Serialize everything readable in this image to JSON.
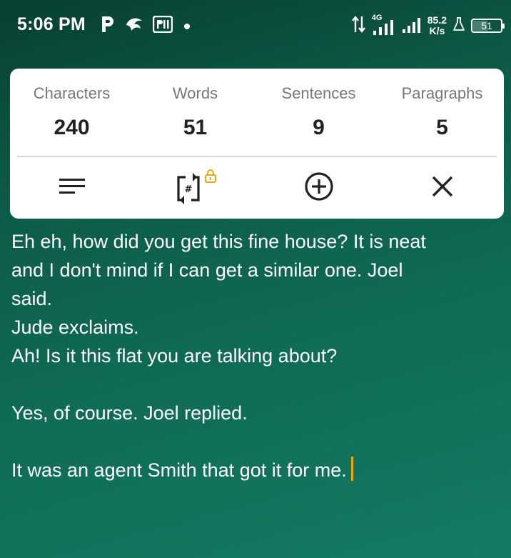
{
  "status_bar": {
    "time": "5:06 PM",
    "network_type": "4G",
    "net_speed_value": "85.2",
    "net_speed_unit": "K/s",
    "battery_level": "51",
    "icons": [
      "p-app-icon",
      "bird-app-icon",
      "pl-app-icon",
      "dot-icon",
      "data-arrows-icon",
      "signal-bars-icon",
      "signal-bars-icon",
      "flask-icon",
      "battery-icon"
    ]
  },
  "stats": [
    {
      "label": "Characters",
      "value": "240"
    },
    {
      "label": "Words",
      "value": "51"
    },
    {
      "label": "Sentences",
      "value": "9"
    },
    {
      "label": "Paragraphs",
      "value": "5"
    }
  ],
  "toolbar": {
    "icons": [
      "text-align-icon",
      "count-replace-icon",
      "add-circle-icon",
      "close-icon"
    ],
    "lock_icon": "lock-icon"
  },
  "editor": {
    "lines": [
      "Eh eh, how did you get this fine house? It is neat",
      "and I don't mind if I can get a similar one. Joel",
      "said.",
      "Jude exclaims.",
      "Ah! Is it this flat you are talking about?",
      "",
      "Yes, of course. Joel replied.",
      "",
      "It was an agent Smith that got it for me."
    ]
  },
  "colors": {
    "background_top": "#083f32",
    "background_bottom": "#157a64",
    "card": "#ffffff",
    "label": "#777777",
    "value": "#222222",
    "cursor": "#f0a500",
    "lock": "#e6a817"
  }
}
